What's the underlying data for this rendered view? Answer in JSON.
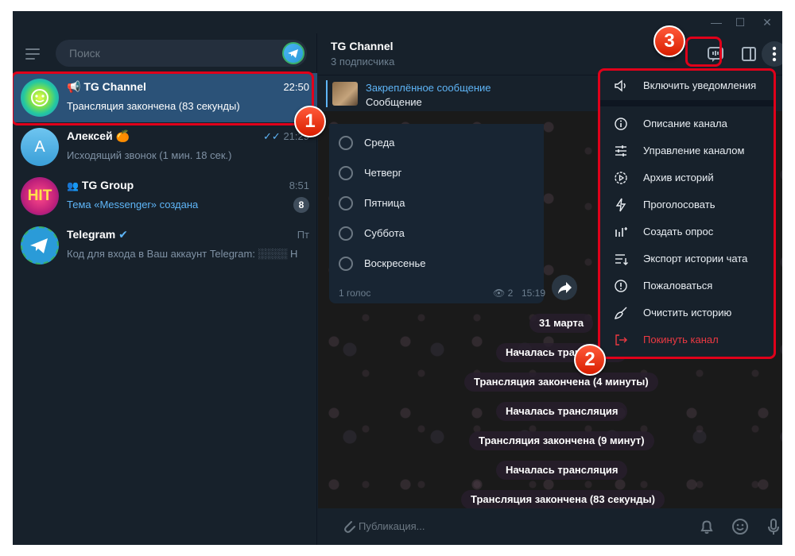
{
  "window": {
    "minimize": "—",
    "maximize": "☐",
    "close": "✕"
  },
  "search": {
    "placeholder": "Поиск"
  },
  "chats": [
    {
      "title": "TG Channel",
      "time": "22:50",
      "snippet": "Трансляция закончена (83 секунды)",
      "active": true
    },
    {
      "title": "Алексей",
      "emoji": "🍊",
      "avatar_letter": "A",
      "time": "21:29",
      "snippet": "Исходящий звонок (1 мин. 18 сек.)"
    },
    {
      "title": "TG Group",
      "time": "8:51",
      "snippet": "Тема «Messenger» создана",
      "badge": "8",
      "avatar_text": "HIT"
    },
    {
      "title": "Telegram",
      "time": "Пт",
      "snippet": "Код для входа в Ваш аккаунт Telegram: ░░░░ Н..."
    }
  ],
  "header": {
    "title": "TG Channel",
    "subtitle": "3 подписчика"
  },
  "pinned": {
    "label": "Закреплённое сообщение",
    "text": "Сообщение"
  },
  "poll": {
    "options": [
      "Среда",
      "Четверг",
      "Пятница",
      "Суббота",
      "Воскресенье"
    ],
    "votes": "1 голос",
    "views": "2",
    "time": "15:19"
  },
  "service_messages": [
    "31 марта",
    "Началась трансляция",
    "Трансляция закончена (4 минуты)",
    "Началась трансляция",
    "Трансляция закончена (9 минут)",
    "Началась трансляция",
    "Трансляция закончена (83 секунды)"
  ],
  "composer": {
    "placeholder": "Публикация..."
  },
  "menu": {
    "top_item": "Включить уведомления",
    "items": [
      {
        "label": "Описание канала",
        "icon": "info-icon"
      },
      {
        "label": "Управление каналом",
        "icon": "sliders-icon"
      },
      {
        "label": "Архив историй",
        "icon": "stories-archive-icon"
      },
      {
        "label": "Проголосовать",
        "icon": "lightning-icon"
      },
      {
        "label": "Создать опрос",
        "icon": "poll-icon"
      },
      {
        "label": "Экспорт истории чата",
        "icon": "export-icon"
      },
      {
        "label": "Пожаловаться",
        "icon": "report-icon"
      },
      {
        "label": "Очистить историю",
        "icon": "broom-icon"
      },
      {
        "label": "Покинуть канал",
        "icon": "leave-icon",
        "danger": true
      }
    ]
  },
  "callouts": [
    "1",
    "2",
    "3"
  ],
  "colors": {
    "highlight": "#e0001a",
    "accent": "#5eb5f7",
    "active_chat": "#2b5278",
    "danger": "#ec3942"
  }
}
